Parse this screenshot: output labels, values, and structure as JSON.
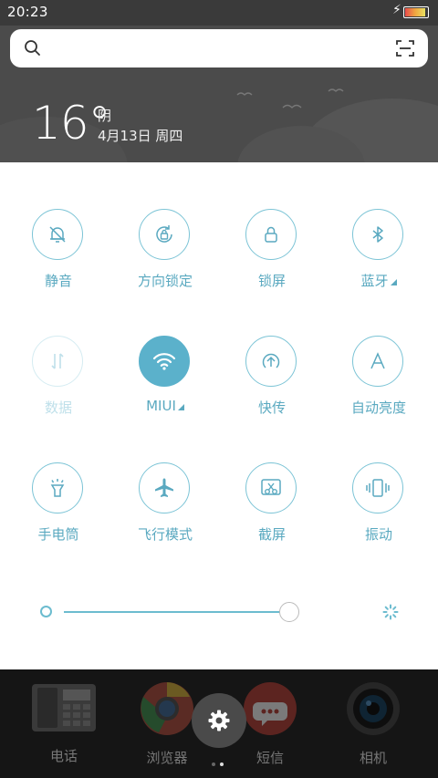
{
  "status_bar": {
    "time": "20:23"
  },
  "weather": {
    "temperature": "16°",
    "condition": "阴",
    "date": "4月13日 周四"
  },
  "toggles": [
    {
      "label": "静音",
      "state": "off",
      "icon": "silent-bell-icon"
    },
    {
      "label": "方向锁定",
      "state": "off",
      "icon": "rotation-lock-icon"
    },
    {
      "label": "锁屏",
      "state": "off",
      "icon": "lock-icon"
    },
    {
      "label": "蓝牙",
      "state": "off",
      "icon": "bluetooth-icon",
      "expandable": true
    },
    {
      "label": "数据",
      "state": "disabled",
      "icon": "data-arrows-icon"
    },
    {
      "label": "MIUI",
      "state": "on",
      "icon": "wifi-icon",
      "expandable": true
    },
    {
      "label": "快传",
      "state": "off",
      "icon": "quick-transfer-icon"
    },
    {
      "label": "自动亮度",
      "state": "off",
      "icon": "auto-brightness-icon"
    },
    {
      "label": "手电筒",
      "state": "off",
      "icon": "flashlight-icon"
    },
    {
      "label": "飞行模式",
      "state": "off",
      "icon": "airplane-icon"
    },
    {
      "label": "截屏",
      "state": "off",
      "icon": "screenshot-icon"
    },
    {
      "label": "振动",
      "state": "off",
      "icon": "vibrate-icon"
    }
  ],
  "brightness": {
    "level": 1.0
  },
  "dock": {
    "apps": [
      {
        "label": "电话",
        "icon": "phone-icon"
      },
      {
        "label": "浏览器",
        "icon": "browser-icon"
      },
      {
        "label": "短信",
        "icon": "messages-icon"
      },
      {
        "label": "相机",
        "icon": "camera-icon"
      }
    ],
    "page_indicator": {
      "count": 2,
      "current": 2
    }
  },
  "colors": {
    "accent": "#5bb1cb",
    "panel_bg": "#ffffff",
    "header_bg": "#4b4b4b"
  }
}
